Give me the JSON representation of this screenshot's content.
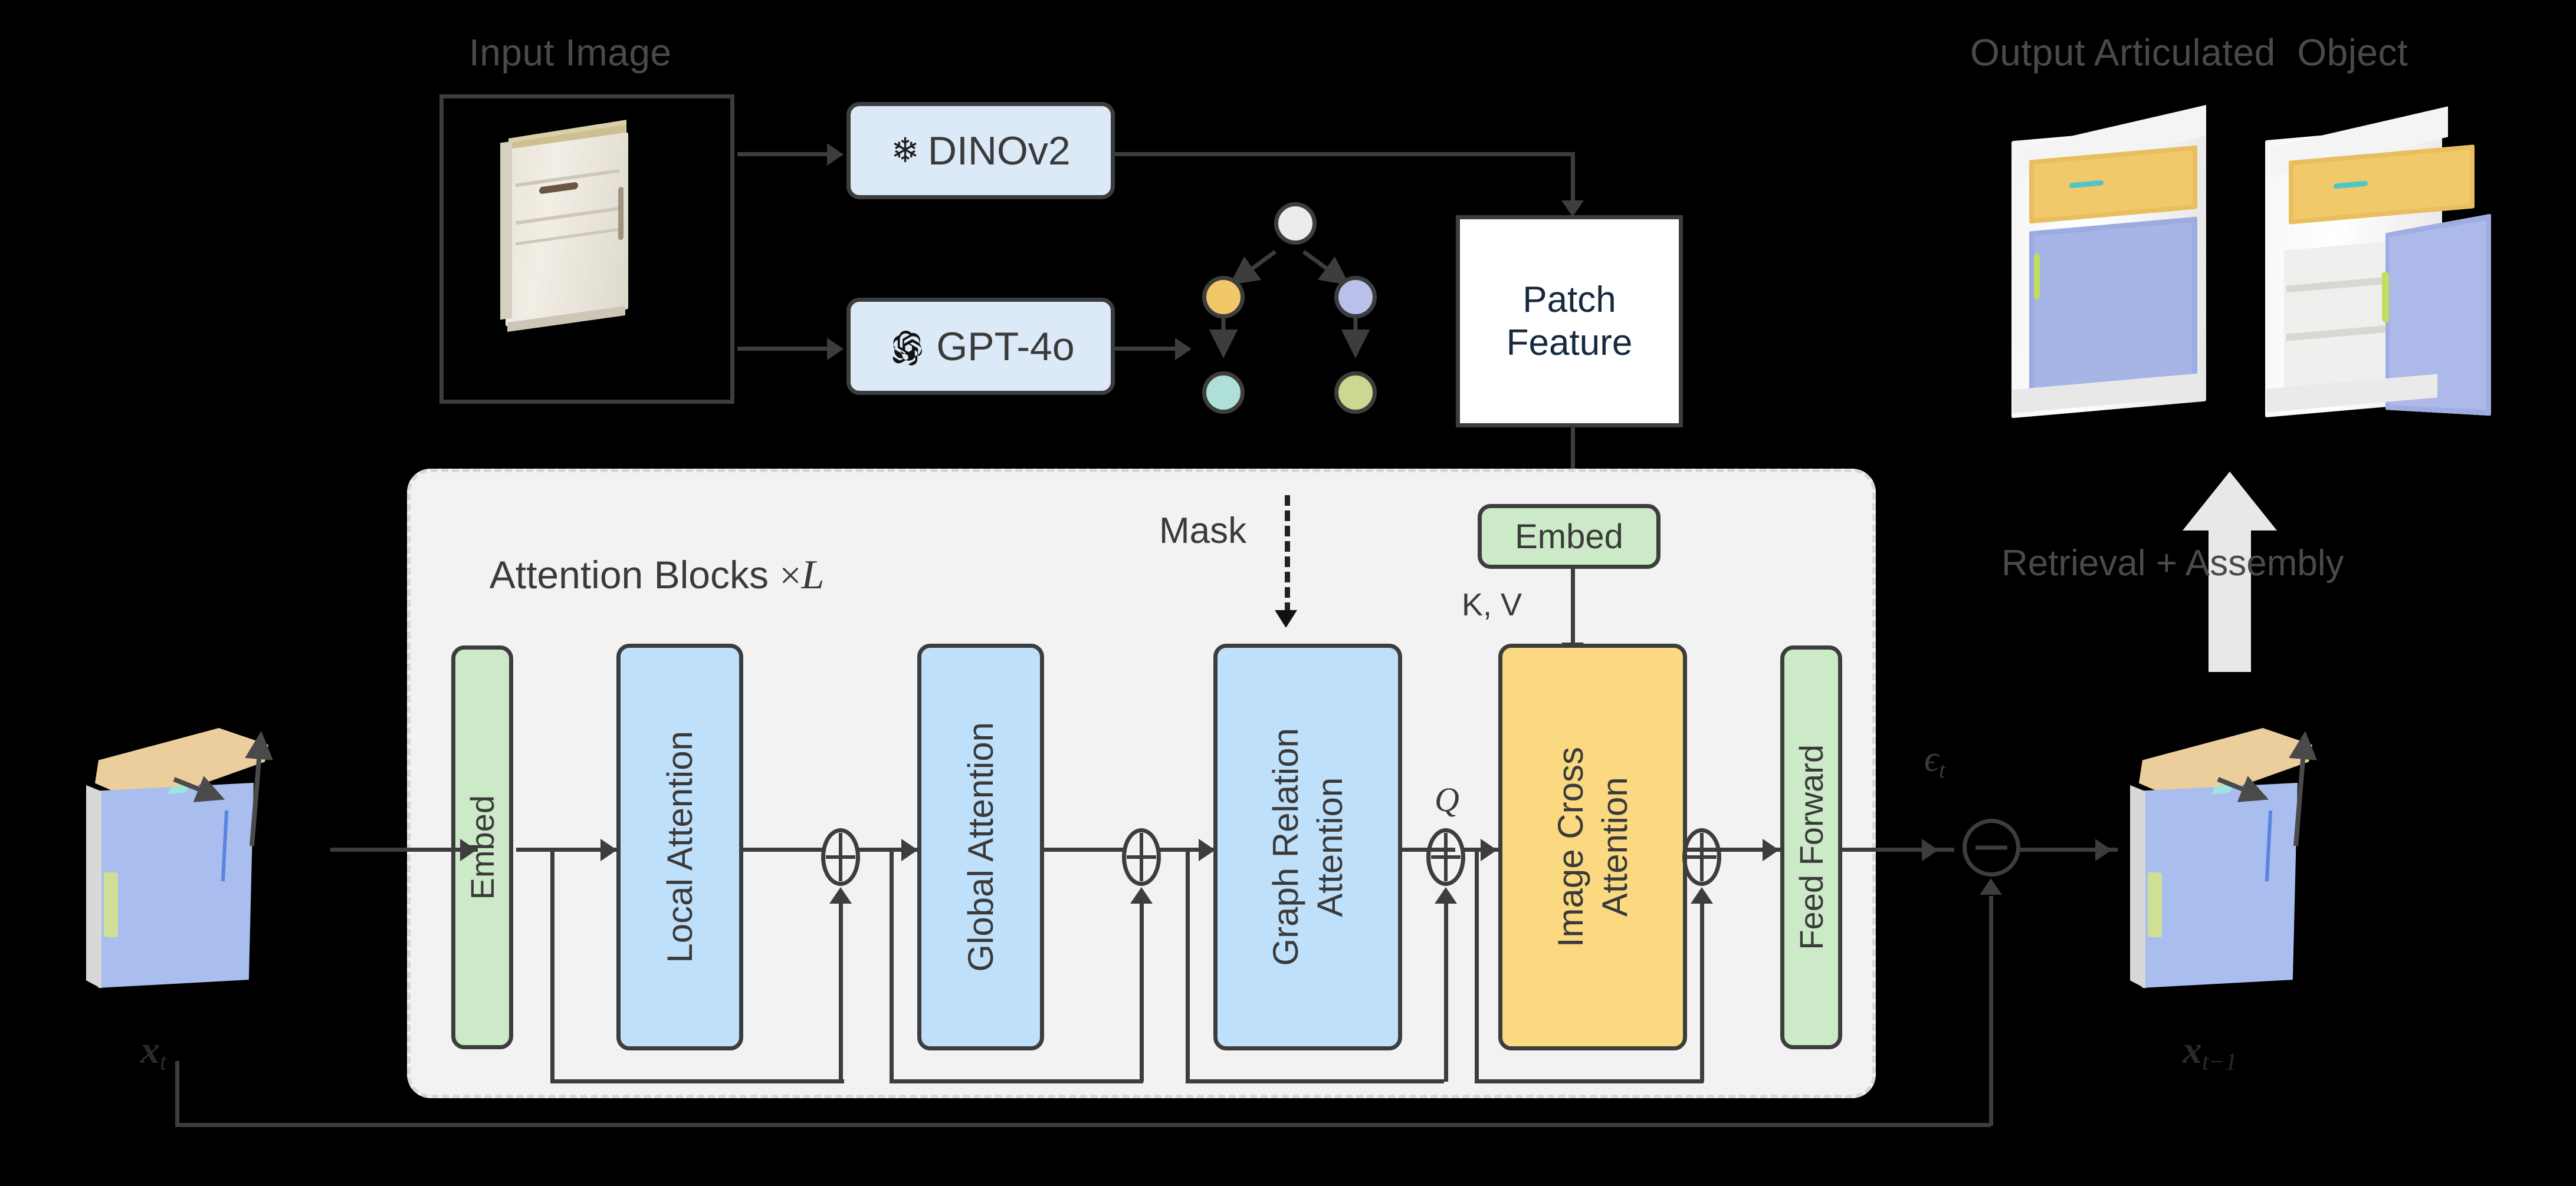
{
  "figure": {
    "title_left": "Input Image",
    "title_right": "Output Articulated  Object",
    "retrieval_label": "Retrieval + Assembly"
  },
  "encoders": {
    "dino": {
      "label": "DINOv2",
      "icon": "snowflake-icon",
      "frozen": true,
      "fill": "#dce9f7"
    },
    "gpt": {
      "label": "GPT-4o",
      "icon": "openai-logo-icon",
      "fill": "#dce9f7"
    }
  },
  "graph": {
    "nodes": [
      {
        "id": "root",
        "color": "#ececec"
      },
      {
        "id": "left",
        "color": "#f2c767"
      },
      {
        "id": "right",
        "color": "#b9c0ea"
      },
      {
        "id": "left_child",
        "color": "#aedfd8"
      },
      {
        "id": "right_child",
        "color": "#ccd892"
      }
    ]
  },
  "patch_feature": {
    "line1": "Patch",
    "line2": "Feature"
  },
  "panel": {
    "title_prefix": "Attention Blocks ",
    "title_times": "×",
    "title_L": "L",
    "mask_label": "Mask",
    "embed_top_label": "Embed",
    "kv_label": "K, V",
    "q_label": "Q",
    "blocks": [
      {
        "name": "embed",
        "label": "Embed",
        "fill": "#cdeac8"
      },
      {
        "name": "local",
        "label": "Local Attention",
        "fill": "#bfe0fb"
      },
      {
        "name": "global",
        "label": "Global Attention",
        "fill": "#bfe0fb"
      },
      {
        "name": "graph",
        "label": "Graph Relation\nAttention",
        "fill": "#bfe0fb"
      },
      {
        "name": "cross",
        "label": "Image Cross\nAttention",
        "fill": "#fbd980"
      },
      {
        "name": "ff",
        "label": "Feed Forward",
        "fill": "#cdeac8"
      }
    ]
  },
  "diffusion": {
    "epsilon_base": "ϵ",
    "epsilon_sub": "t",
    "x_in_base": "x",
    "x_in_sub": "t",
    "x_out_base": "x",
    "x_out_sub": "t−1",
    "subtract_symbol": "−"
  },
  "operators": {
    "add_symbol": "⊕",
    "count": 4
  },
  "colors": {
    "stroke": "#3d3d3d",
    "panel_bg": "#f2f2f2",
    "panel_border": "#d8d8d8",
    "caption": "#4a4a4a",
    "background": "#000000",
    "box_blue": "#dce9f7",
    "box_lightblue": "#bfe0fb",
    "box_green": "#cdeac8",
    "box_yellow": "#fbd980",
    "box_white": "#ffffff",
    "big_arrow": "#e8e8e8"
  }
}
